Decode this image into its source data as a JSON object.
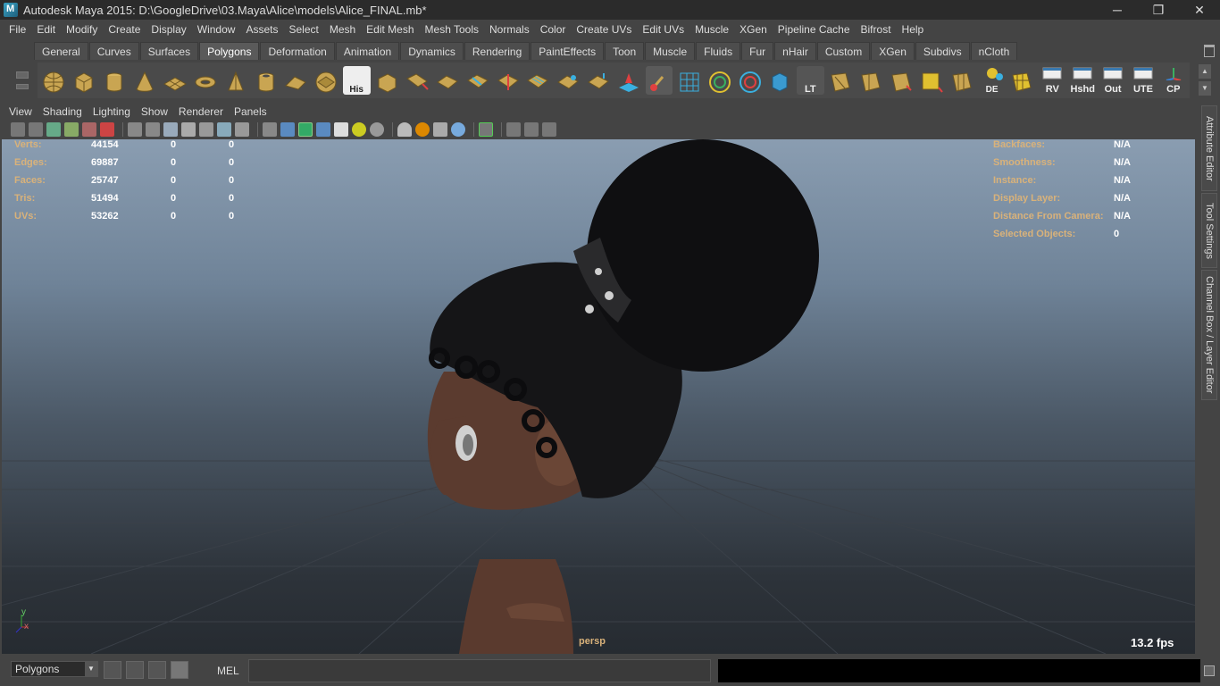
{
  "window": {
    "title": "Autodesk Maya 2015: D:\\GoogleDrive\\03.Maya\\Alice\\models\\Alice_FINAL.mb*",
    "minimize": "─",
    "restore": "❐",
    "close": "✕"
  },
  "menubar": [
    "File",
    "Edit",
    "Modify",
    "Create",
    "Display",
    "Window",
    "Assets",
    "Select",
    "Mesh",
    "Edit Mesh",
    "Mesh Tools",
    "Normals",
    "Color",
    "Create UVs",
    "Edit UVs",
    "Muscle",
    "XGen",
    "Pipeline Cache",
    "Bifrost",
    "Help"
  ],
  "shelf": {
    "tabs": [
      "General",
      "Curves",
      "Surfaces",
      "Polygons",
      "Deformation",
      "Animation",
      "Dynamics",
      "Rendering",
      "PaintEffects",
      "Toon",
      "Muscle",
      "Fluids",
      "Fur",
      "nHair",
      "Custom",
      "XGen",
      "Subdivs",
      "nCloth"
    ],
    "active_tab": "Polygons",
    "labeled_icons": {
      "his": "His",
      "lt": "LT",
      "de": "DE",
      "rv": "RV",
      "hshd": "Hshd",
      "out": "Out",
      "ute": "UTE",
      "cp": "CP"
    }
  },
  "panel_menu": [
    "View",
    "Shading",
    "Lighting",
    "Show",
    "Renderer",
    "Panels"
  ],
  "hud_left": [
    {
      "label": "Verts:",
      "v1": "44154",
      "v2": "0",
      "v3": "0"
    },
    {
      "label": "Edges:",
      "v1": "69887",
      "v2": "0",
      "v3": "0"
    },
    {
      "label": "Faces:",
      "v1": "25747",
      "v2": "0",
      "v3": "0"
    },
    {
      "label": "Tris:",
      "v1": "51494",
      "v2": "0",
      "v3": "0"
    },
    {
      "label": "UVs:",
      "v1": "53262",
      "v2": "0",
      "v3": "0"
    }
  ],
  "hud_right": [
    {
      "label": "Backfaces:",
      "value": "N/A"
    },
    {
      "label": "Smoothness:",
      "value": "N/A"
    },
    {
      "label": "Instance:",
      "value": "N/A"
    },
    {
      "label": "Display Layer:",
      "value": "N/A"
    },
    {
      "label": "Distance From Camera:",
      "value": "N/A"
    },
    {
      "label": "Selected Objects:",
      "value": "0"
    }
  ],
  "viewport": {
    "camera": "persp",
    "fps": "13.2 fps",
    "axis_y": "y",
    "axis_x": "x"
  },
  "right_tabs": [
    "Attribute Editor",
    "Tool Settings",
    "Channel Box / Layer Editor"
  ],
  "bottombar": {
    "mode": "Polygons",
    "script_type": "MEL",
    "command": ""
  },
  "colors": {
    "skin": "#5a3a2e",
    "hair": "#151517",
    "hud_label": "#d9b27a",
    "accent_tab": "#5a5a5a"
  }
}
